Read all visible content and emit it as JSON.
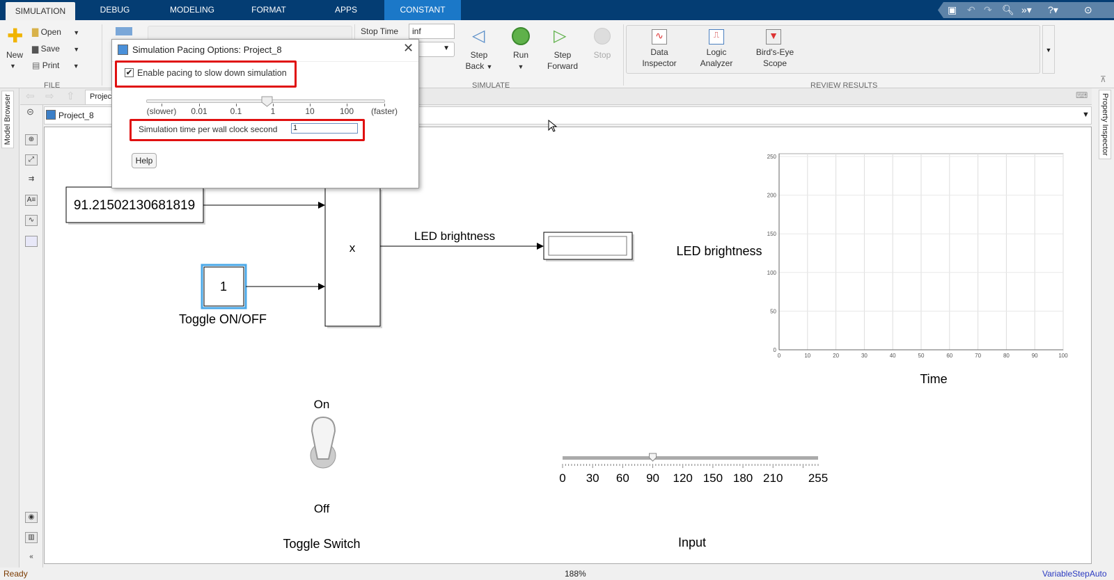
{
  "tabs": [
    {
      "label": "SIMULATION",
      "selected": true
    },
    {
      "label": "DEBUG"
    },
    {
      "label": "MODELING"
    },
    {
      "label": "FORMAT"
    },
    {
      "label": "APPS"
    },
    {
      "label": "CONSTANT",
      "contextual": true
    }
  ],
  "ribbon": {
    "file": {
      "new": "New",
      "open": "Open",
      "save": "Save",
      "print": "Print",
      "group": "FILE"
    },
    "stop_time_label": "Stop Time",
    "stop_time_value": "inf",
    "simulate": {
      "step_back": "Step",
      "step_back2": "Back",
      "run": "Run",
      "step_forward": "Step",
      "step_forward2": "Forward",
      "stop": "Stop",
      "group": "SIMULATE"
    },
    "review": {
      "data_inspector": "Data",
      "data_inspector2": "Inspector",
      "logic_analyzer": "Logic",
      "logic_analyzer2": "Analyzer",
      "birds_eye": "Bird's-Eye",
      "birds_eye2": "Scope",
      "group": "REVIEW RESULTS"
    }
  },
  "nav": {
    "tab": "Project_8"
  },
  "model": {
    "name": "Project_8"
  },
  "left_strip": {
    "label": "Model Browser"
  },
  "right_strip": {
    "label": "Property Inspector"
  },
  "dialog": {
    "title": "Simulation Pacing Options: Project_8",
    "checkbox_label": "Enable pacing to slow down simulation",
    "checked": true,
    "slider_labels": [
      "(slower)",
      "0.01",
      "0.1",
      "1",
      "10",
      "100",
      "(faster)"
    ],
    "slider_value": 1,
    "field_label": "Simulation time per wall clock second",
    "field_value": "1",
    "help": "Help",
    "highlight_color": "#e01010"
  },
  "diagram": {
    "constant_value": "91.21502130681819",
    "product_label": "x",
    "toggle_const": "1",
    "toggle_label": "Toggle ON/OFF",
    "signal_label": "LED brightness",
    "scope_ylabel": "LED brightness",
    "scope_xlabel": "Time",
    "scope_xticks": [
      "0",
      "10",
      "20",
      "30",
      "40",
      "50",
      "60",
      "70",
      "80",
      "90",
      "100"
    ],
    "scope_yticks": [
      "0",
      "50",
      "100",
      "150",
      "200",
      "250"
    ],
    "switch_on": "On",
    "switch_off": "Off",
    "switch_label": "Toggle Switch",
    "slider_ticks": [
      "0",
      "30",
      "60",
      "90",
      "120",
      "150",
      "180",
      "210",
      "255"
    ],
    "slider_value": 90,
    "slider_max": 255,
    "slider_label": "Input"
  },
  "status": {
    "left": "Ready",
    "zoom": "188%",
    "solver": "VariableStepAuto"
  }
}
